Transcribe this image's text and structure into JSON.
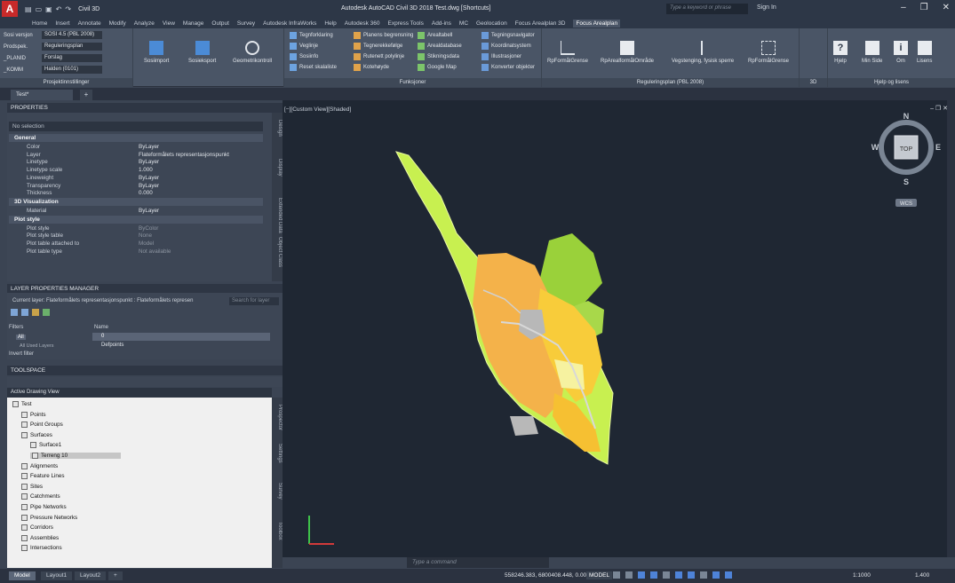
{
  "window": {
    "title": "Autodesk AutoCAD Civil 3D 2018   Test.dwg [Shortcuts]",
    "workspace": "Civil 3D",
    "search_placeholder": "Type a keyword or phrase",
    "signin": "Sign In"
  },
  "ribbon_tabs": [
    "Home",
    "Insert",
    "Annotate",
    "Modify",
    "Analyze",
    "View",
    "Manage",
    "Output",
    "Survey",
    "Autodesk InfraWorks",
    "Help",
    "Autodesk 360",
    "Express Tools",
    "Add-ins",
    "MC",
    "Geolocation",
    "Focus Arealplan 3D",
    "Focus Arealplan"
  ],
  "ribbon_active_tab": "Focus Arealplan",
  "ribbon": {
    "prosjekt": {
      "rows": [
        {
          "label": "Sosi versjon",
          "value": "SOSI 4.5 (PBL 2008)"
        },
        {
          "label": "Prodspek.",
          "value": "Reguleringsplan"
        },
        {
          "label": "_PLANID",
          "value": "Forslag"
        },
        {
          "label": "_KOMM",
          "value": "Halden (0101)"
        }
      ],
      "group_label": "Prosjektinnstillinger"
    },
    "big_buttons": [
      "Sosiimport",
      "Sosieksport",
      "Geometrikontroll"
    ],
    "funksjoner": {
      "col1": [
        "Tegnforklaring",
        "Veglinje",
        "Sosiinfo",
        "Reset skalaliste"
      ],
      "col2": [
        "Planens begrensning",
        "Tegnerekkefølge",
        "Rutenett polylinje",
        "Kotehøyde"
      ],
      "col3": [
        "Arealtabell",
        "Arealdatabase",
        "Stikningsdata",
        "Google Map"
      ],
      "col4": [
        "Tegningsnavigator",
        "Koordinatsystem",
        "Illustrasjoner",
        "Konverter objekter"
      ],
      "group_label": "Funksjoner"
    },
    "regulering": {
      "buttons": [
        "RpFormålGrense",
        "RpArealformålOmråde",
        "Vegstenging, fysisk sperre",
        "RpFormålGrense"
      ],
      "group_label": "Reguleringsplan (PBL 2008)"
    },
    "group_3d": "3D",
    "help": {
      "buttons": [
        "Hjelp",
        "Min Side",
        "Om",
        "Lisens"
      ],
      "group_label": "Hjelp og lisens"
    }
  },
  "doc_tab": "Test*",
  "properties": {
    "header": "PROPERTIES",
    "selection": "No selection",
    "sections": {
      "general": "General",
      "viz": "3D Visualization",
      "plot": "Plot style"
    },
    "general_rows": [
      {
        "k": "Color",
        "v": "ByLayer"
      },
      {
        "k": "Layer",
        "v": "Flateformålets representasjonspunkt"
      },
      {
        "k": "Linetype",
        "v": "ByLayer"
      },
      {
        "k": "Linetype scale",
        "v": "1.000"
      },
      {
        "k": "Lineweight",
        "v": "ByLayer"
      },
      {
        "k": "Transparency",
        "v": "ByLayer"
      },
      {
        "k": "Thickness",
        "v": "0.000"
      }
    ],
    "viz_rows": [
      {
        "k": "Material",
        "v": "ByLayer"
      }
    ],
    "plot_rows": [
      {
        "k": "Plot style",
        "v": "ByColor"
      },
      {
        "k": "Plot style table",
        "v": "None"
      },
      {
        "k": "Plot table attached to",
        "v": "Model"
      },
      {
        "k": "Plot table type",
        "v": "Not available"
      }
    ],
    "side_tabs": [
      "Design",
      "Display",
      "Extended Data",
      "Object Class"
    ]
  },
  "layer_manager": {
    "header": "LAYER PROPERTIES MANAGER",
    "current": "Current layer: Flateformålets representasjonspunkt : Flateformålets represen",
    "search": "Search for layer",
    "filters_label": "Filters",
    "name_col": "Name",
    "all": "All",
    "all_used": "All Used Layers",
    "invert": "Invert filter",
    "layers": [
      "0",
      "Defpoints"
    ]
  },
  "toolspace": {
    "header": "TOOLSPACE",
    "view_select": "Active Drawing View",
    "items": [
      {
        "label": "Test",
        "level": 0
      },
      {
        "label": "Points",
        "level": 1
      },
      {
        "label": "Point Groups",
        "level": 1
      },
      {
        "label": "Surfaces",
        "level": 1
      },
      {
        "label": "Surface1",
        "level": 2
      },
      {
        "label": "Terreng 10",
        "level": 2
      },
      {
        "label": "Alignments",
        "level": 1
      },
      {
        "label": "Feature Lines",
        "level": 1
      },
      {
        "label": "Sites",
        "level": 1
      },
      {
        "label": "Catchments",
        "level": 1
      },
      {
        "label": "Pipe Networks",
        "level": 1
      },
      {
        "label": "Pressure Networks",
        "level": 1
      },
      {
        "label": "Corridors",
        "level": 1
      },
      {
        "label": "Assemblies",
        "level": 1
      },
      {
        "label": "Intersections",
        "level": 1
      }
    ],
    "side_tabs": [
      "Prospector",
      "Settings",
      "Survey",
      "Toolbox"
    ]
  },
  "viewport": {
    "label": "[−][Custom View][Shaded]",
    "compass": {
      "n": "N",
      "s": "S",
      "e": "E",
      "w": "W",
      "top": "TOP"
    },
    "ucs": "WCS"
  },
  "command_placeholder": "Type a command",
  "status": {
    "tabs": [
      "Model",
      "Layout1",
      "Layout2"
    ],
    "coords": "558246.383, 6800408.448, 0.000",
    "model": "MODEL",
    "scale": "1:1000",
    "scale2": "1.400"
  },
  "colors": {
    "plan_light": "#c8f050",
    "plan_orange": "#f4b24a",
    "plan_yellow": "#f8cc3a",
    "plan_green": "#9ad13a",
    "plan_gray": "#b8b8b8"
  }
}
